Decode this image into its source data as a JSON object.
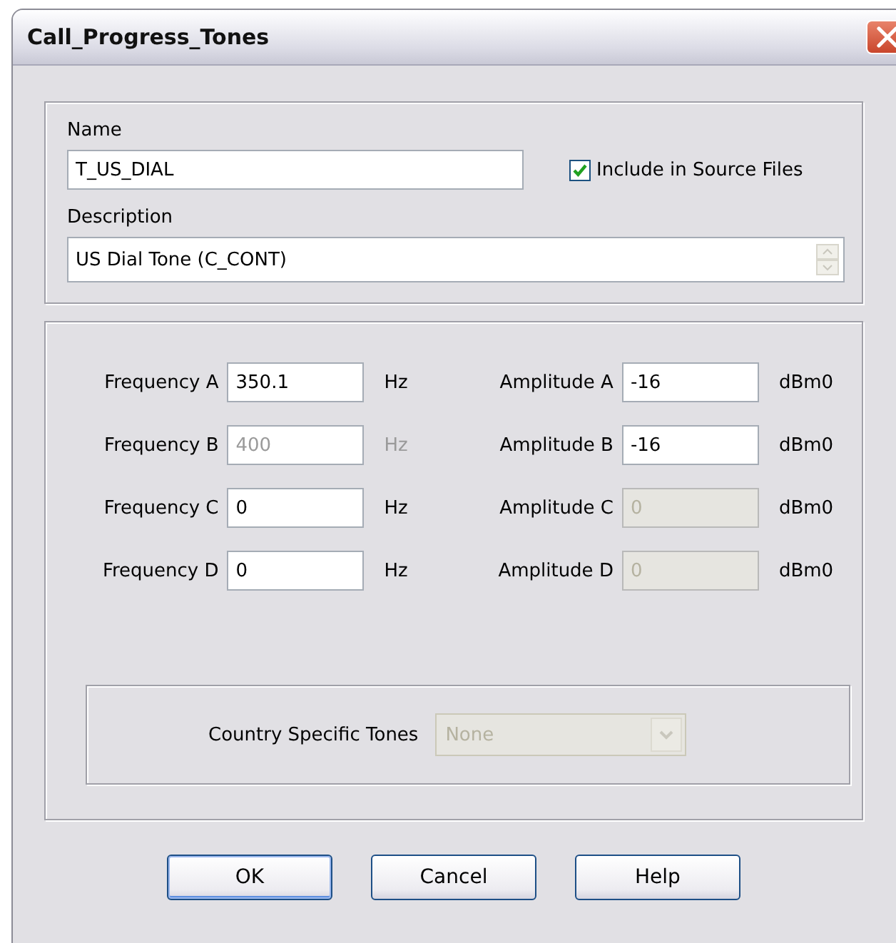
{
  "window": {
    "title": "Call_Progress_Tones"
  },
  "name": {
    "label": "Name",
    "value": "T_US_DIAL"
  },
  "include_source": {
    "label": "Include in Source Files",
    "checked": true
  },
  "description": {
    "label": "Description",
    "value": "US Dial Tone (C_CONT)"
  },
  "rows": [
    {
      "freq": {
        "label": "Frequency A",
        "value": "350.1",
        "unit": "Hz",
        "greyed": false,
        "disabled": false
      },
      "amp": {
        "label": "Amplitude A",
        "value": "-16",
        "unit": "dBm0",
        "greyed": false,
        "disabled": false
      }
    },
    {
      "freq": {
        "label": "Frequency B",
        "value": "400",
        "unit": "Hz",
        "greyed": true,
        "disabled": false
      },
      "amp": {
        "label": "Amplitude B",
        "value": "-16",
        "unit": "dBm0",
        "greyed": false,
        "disabled": false
      }
    },
    {
      "freq": {
        "label": "Frequency C",
        "value": "0",
        "unit": "Hz",
        "greyed": false,
        "disabled": false
      },
      "amp": {
        "label": "Amplitude C",
        "value": "0",
        "unit": "dBm0",
        "greyed": false,
        "disabled": true
      }
    },
    {
      "freq": {
        "label": "Frequency D",
        "value": "0",
        "unit": "Hz",
        "greyed": false,
        "disabled": false
      },
      "amp": {
        "label": "Amplitude D",
        "value": "0",
        "unit": "dBm0",
        "greyed": false,
        "disabled": true
      }
    }
  ],
  "country": {
    "label": "Country Specific Tones",
    "value": "None",
    "disabled": true
  },
  "buttons": [
    {
      "label": "OK",
      "default": true
    },
    {
      "label": "Cancel",
      "default": false
    },
    {
      "label": "Help",
      "default": false
    }
  ]
}
